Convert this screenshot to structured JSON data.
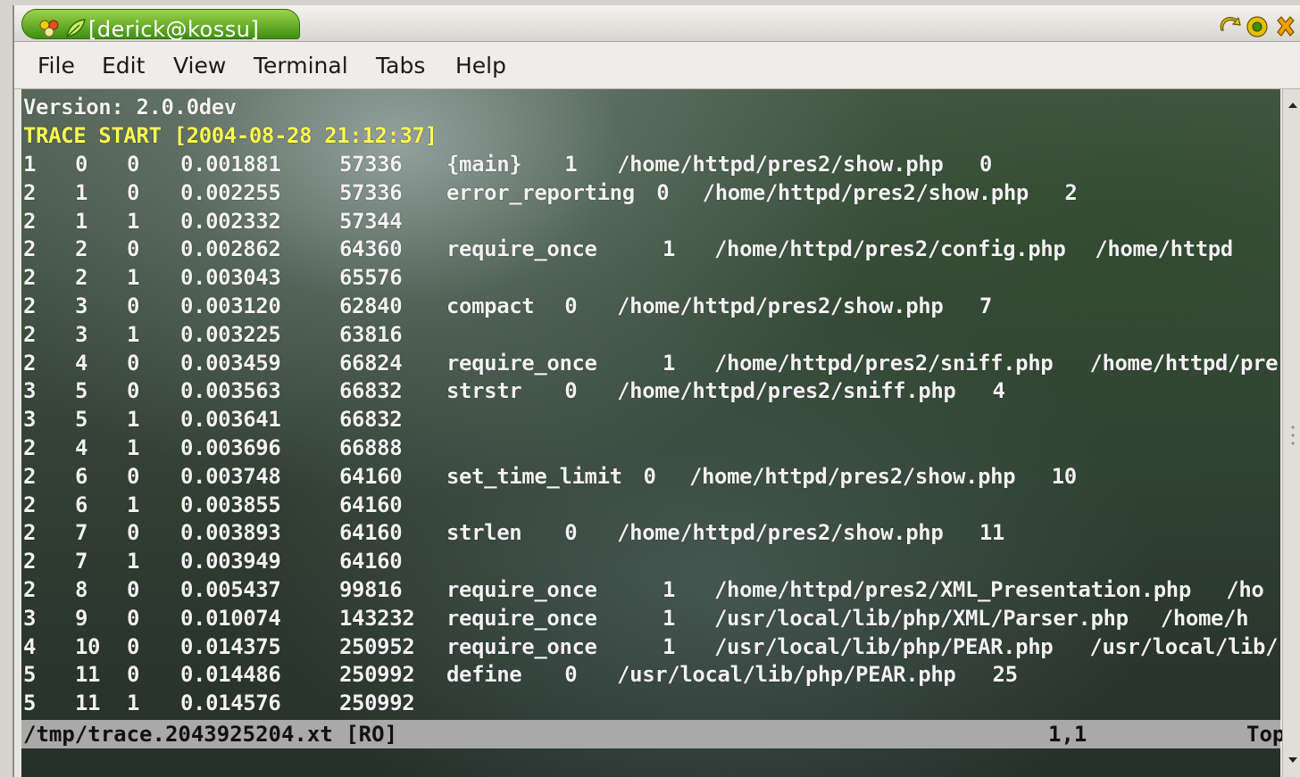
{
  "window": {
    "title": "[derick@kossu]"
  },
  "menu": [
    "File",
    "Edit",
    "View",
    "Terminal",
    "Tabs",
    "Help"
  ],
  "terminal": {
    "version_line": "Version: 2.0.0dev",
    "trace_line": "TRACE START [2004-08-28 21:12:37]",
    "rows": [
      [
        "1",
        "0",
        "0",
        "0.001881",
        "57336",
        "{main}",
        "1",
        "/home/httpd/pres2/show.php",
        "0"
      ],
      [
        "2",
        "1",
        "0",
        "0.002255",
        "57336",
        "error_reporting",
        "0",
        "/home/httpd/pres2/show.php",
        "2"
      ],
      [
        "2",
        "1",
        "1",
        "0.002332",
        "57344",
        "",
        "",
        "",
        ""
      ],
      [
        "2",
        "2",
        "0",
        "0.002862",
        "64360",
        "require_once",
        "1",
        "/home/httpd/pres2/config.php",
        "/home/httpd"
      ],
      [
        "2",
        "2",
        "1",
        "0.003043",
        "65576",
        "",
        "",
        "",
        ""
      ],
      [
        "2",
        "3",
        "0",
        "0.003120",
        "62840",
        "compact",
        "0",
        "/home/httpd/pres2/show.php",
        "7"
      ],
      [
        "2",
        "3",
        "1",
        "0.003225",
        "63816",
        "",
        "",
        "",
        ""
      ],
      [
        "2",
        "4",
        "0",
        "0.003459",
        "66824",
        "require_once",
        "1",
        "/home/httpd/pres2/sniff.php",
        "/home/httpd/pre"
      ],
      [
        "3",
        "5",
        "0",
        "0.003563",
        "66832",
        "strstr",
        "0",
        "/home/httpd/pres2/sniff.php",
        "4"
      ],
      [
        "3",
        "5",
        "1",
        "0.003641",
        "66832",
        "",
        "",
        "",
        ""
      ],
      [
        "2",
        "4",
        "1",
        "0.003696",
        "66888",
        "",
        "",
        "",
        ""
      ],
      [
        "2",
        "6",
        "0",
        "0.003748",
        "64160",
        "set_time_limit",
        "0",
        "/home/httpd/pres2/show.php",
        "10"
      ],
      [
        "2",
        "6",
        "1",
        "0.003855",
        "64160",
        "",
        "",
        "",
        ""
      ],
      [
        "2",
        "7",
        "0",
        "0.003893",
        "64160",
        "strlen",
        "0",
        "/home/httpd/pres2/show.php",
        "11"
      ],
      [
        "2",
        "7",
        "1",
        "0.003949",
        "64160",
        "",
        "",
        "",
        ""
      ],
      [
        "2",
        "8",
        "0",
        "0.005437",
        "99816",
        "require_once",
        "1",
        "/home/httpd/pres2/XML_Presentation.php",
        "/ho"
      ],
      [
        "3",
        "9",
        "0",
        "0.010074",
        "143232",
        "require_once",
        "1",
        "/usr/local/lib/php/XML/Parser.php",
        "/home/h"
      ],
      [
        "4",
        "10",
        "0",
        "0.014375",
        "250952",
        "require_once",
        "1",
        "/usr/local/lib/php/PEAR.php",
        "/usr/local/lib/"
      ],
      [
        "5",
        "11",
        "0",
        "0.014486",
        "250992",
        "define",
        "0",
        "/usr/local/lib/php/PEAR.php",
        "25"
      ],
      [
        "5",
        "11",
        "1",
        "0.014576",
        "250992",
        "",
        "",
        "",
        ""
      ]
    ]
  },
  "status": {
    "file": "/tmp/trace.2043925204.xt [RO]",
    "position": "1,1",
    "scroll": "Top"
  },
  "colors": {
    "title_green": "#3e8f12",
    "trace_yellow": "#ffff55",
    "text_white": "#f2f2f2",
    "status_gray": "#a9a9a9"
  }
}
